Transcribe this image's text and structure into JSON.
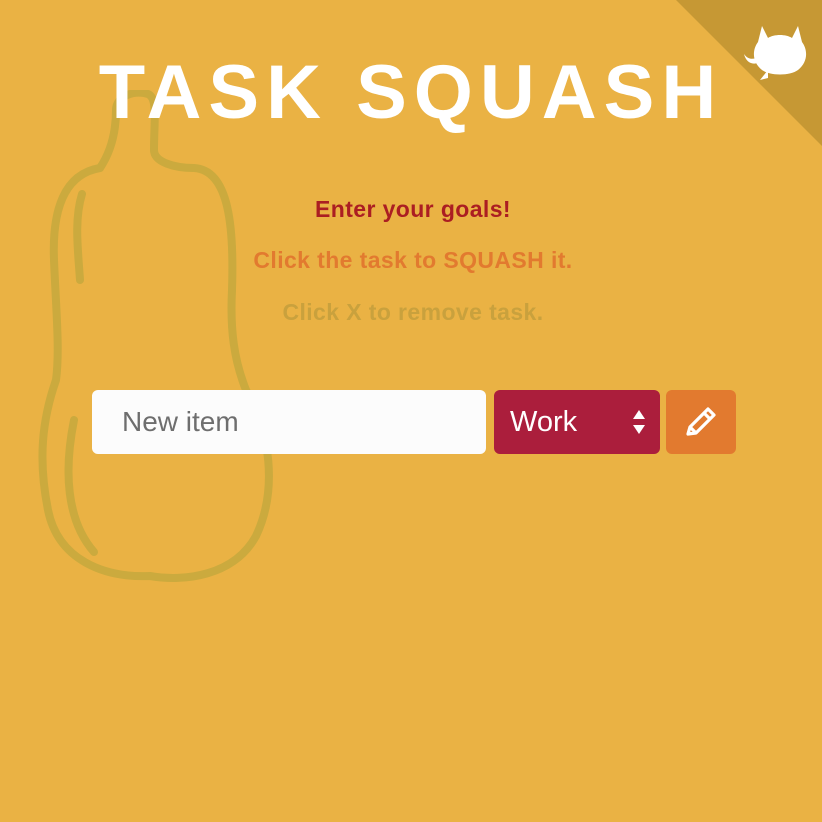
{
  "header": {
    "title": "TASK SQUASH",
    "corner_icon": "github-octocat-icon"
  },
  "instructions": [
    "Enter your goals!",
    "Click the task to SQUASH it.",
    "Click X to remove task."
  ],
  "form": {
    "input_placeholder": "New item",
    "input_value": "",
    "category_selected": "Work",
    "add_button_icon": "pencil-icon"
  },
  "decor": {
    "background_icon": "butternut-squash-icon"
  },
  "colors": {
    "background": "#EAB244",
    "title": "#FFFFFF",
    "corner": "#C69834",
    "instruction_1": "#AB1E22",
    "instruction_2": "#E27A2F",
    "instruction_3": "#C9A13D",
    "select_bg": "#AB1E3C",
    "button_bg": "#E27A2F",
    "squash_outline": "#CBAA3E"
  }
}
